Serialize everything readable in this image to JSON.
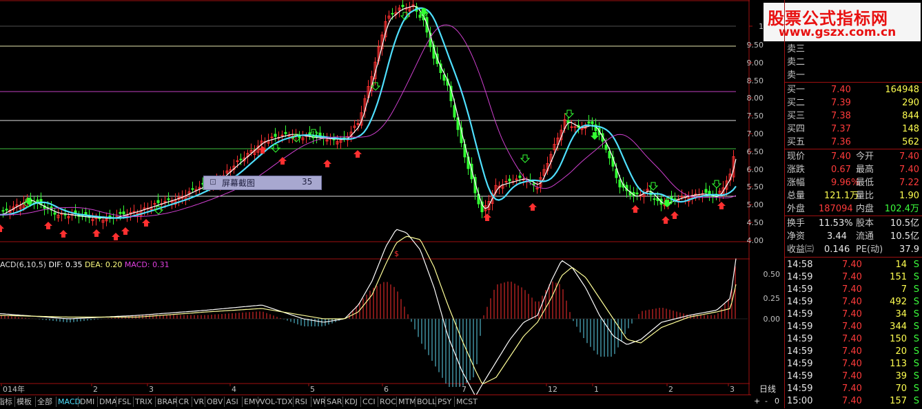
{
  "watermark": {
    "line1": "股票公式指标网",
    "line2": "www.gszx.com.cn"
  },
  "price_axis": [
    "1",
    "9.50",
    "9.00",
    "8.50",
    "8.00",
    "7.50",
    "7.00",
    "6.50",
    "6.00",
    "5.50",
    "5.00",
    "4.50",
    "4.00"
  ],
  "macd_axis": [
    "0.50",
    "0.25",
    "0.00"
  ],
  "date_axis": [
    "014年",
    "2",
    "3",
    "4",
    "5",
    "6",
    "7",
    "12",
    "1",
    "2",
    "3"
  ],
  "marker_s": "$",
  "macd_header": {
    "name": "ACD(6,10,5)",
    "dif_label": "DIF: 0.35",
    "dea_label": "DEA: 0.20",
    "macd_label": "MACD: 0.31"
  },
  "screenshot_tip": {
    "label": "屏幕截图",
    "value": "35"
  },
  "colors": {
    "up": "#ff3030",
    "down": "#33ff33",
    "ma_fast": "#ffffff",
    "ma_mid": "#4fe0ff",
    "ma_slow": "#d040d0",
    "dif": "#ffffff",
    "dea": "#ffff99"
  },
  "order_book": {
    "sells": [
      {
        "label": "卖三"
      },
      {
        "label": "卖二"
      },
      {
        "label": "卖一"
      }
    ],
    "buys": [
      {
        "label": "买一",
        "price": "7.40",
        "vol": "164948"
      },
      {
        "label": "买二",
        "price": "7.39",
        "vol": "290"
      },
      {
        "label": "买三",
        "price": "7.38",
        "vol": "844"
      },
      {
        "label": "买四",
        "price": "7.37",
        "vol": "148"
      },
      {
        "label": "买五",
        "price": "7.36",
        "vol": "562"
      }
    ]
  },
  "quote": {
    "xianjia_l": "现价",
    "xianjia": "7.40",
    "jinkai_l": "今开",
    "jinkai": "7.40",
    "zhangdie_l": "涨跌",
    "zhangdie": "0.67",
    "zuigao_l": "最高",
    "zuigao": "7.40",
    "zhangfu_l": "涨幅",
    "zhangfu": "9.96%",
    "zuidi_l": "最低",
    "zuidi": "7.22",
    "zongliang_l": "总量",
    "zongliang": "121.1万",
    "liangbi_l": "量比",
    "liangbi": "1.90",
    "waipan_l": "外盘",
    "waipan": "187094",
    "neipan_l": "内盘",
    "neipan": "102.4万",
    "huanshou_l": "换手",
    "huanshou": "11.53%",
    "guben_l": "股本",
    "guben": "10.5亿",
    "jingzi_l": "净资",
    "jingzi": "3.44",
    "liutong_l": "流通",
    "liutong": "10.5亿",
    "shouyi_l": "收益㈢",
    "shouyi": "0.146",
    "pe_l": "PE(动)",
    "pe": "37.9"
  },
  "ticks": [
    {
      "time": "14:58",
      "price": "7.40",
      "vol": "14",
      "side": "S"
    },
    {
      "time": "14:59",
      "price": "7.40",
      "vol": "151",
      "side": "S"
    },
    {
      "time": "14:59",
      "price": "7.40",
      "vol": "7",
      "side": "S"
    },
    {
      "time": "14:59",
      "price": "7.40",
      "vol": "492",
      "side": "S"
    },
    {
      "time": "14:59",
      "price": "7.40",
      "vol": "34",
      "side": "S"
    },
    {
      "time": "14:59",
      "price": "7.40",
      "vol": "344",
      "side": "S"
    },
    {
      "time": "14:59",
      "price": "7.40",
      "vol": "150",
      "side": "S"
    },
    {
      "time": "14:59",
      "price": "7.40",
      "vol": "20",
      "side": "S"
    },
    {
      "time": "14:59",
      "price": "7.40",
      "vol": "113",
      "side": "S"
    },
    {
      "time": "14:59",
      "price": "7.40",
      "vol": "39",
      "side": "S"
    },
    {
      "time": "14:59",
      "price": "7.40",
      "vol": "70",
      "side": "S"
    },
    {
      "time": "15:00",
      "price": "7.40",
      "vol": "157",
      "side": "S"
    }
  ],
  "period": "日线",
  "zoom": {
    "plus": "+",
    "minus": "-",
    "zero": "0"
  },
  "tabs": [
    "指标",
    "模板",
    "全部",
    "MACD",
    "DMI",
    "DMA",
    "FSL",
    "TRIX",
    "BRAR",
    "CR",
    "VR",
    "OBV",
    "ASI",
    "EMV",
    "VOL-TDX",
    "RSI",
    "WR",
    "SAR",
    "KDJ",
    "CCI",
    "ROC",
    "MTM",
    "BOLL",
    "PSY",
    "MCST"
  ],
  "active_tab": "MACD"
}
